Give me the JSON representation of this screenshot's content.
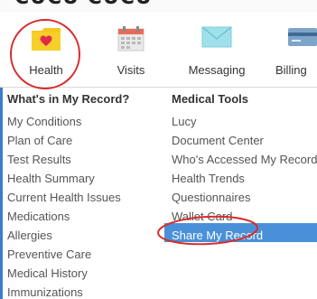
{
  "header_partial_text": "CUCU CUCU",
  "tabs": [
    {
      "label": "Health",
      "icon": "folder-heart-icon"
    },
    {
      "label": "Visits",
      "icon": "calendar-icon"
    },
    {
      "label": "Messaging",
      "icon": "envelope-icon"
    },
    {
      "label": "Billing",
      "icon": "credit-card-icon"
    }
  ],
  "record_menu": {
    "heading": "What's in My Record?",
    "items": [
      "My Conditions",
      "Plan of Care",
      "Test Results",
      "Health Summary",
      "Current Health Issues",
      "Medications",
      "Allergies",
      "Preventive Care",
      "Medical History",
      "Immunizations"
    ]
  },
  "tools_menu": {
    "heading": "Medical Tools",
    "items": [
      "Lucy",
      "Document Center",
      "Who's Accessed My Record?",
      "Health Trends",
      "Questionnaires",
      "Wallet Card",
      "Share My Record"
    ],
    "active_item": "Share My Record"
  },
  "colors": {
    "highlight": "#4a90d9",
    "annotation": "#d62d2d",
    "folder": "#f5c81e",
    "heart": "#e02a4a"
  }
}
